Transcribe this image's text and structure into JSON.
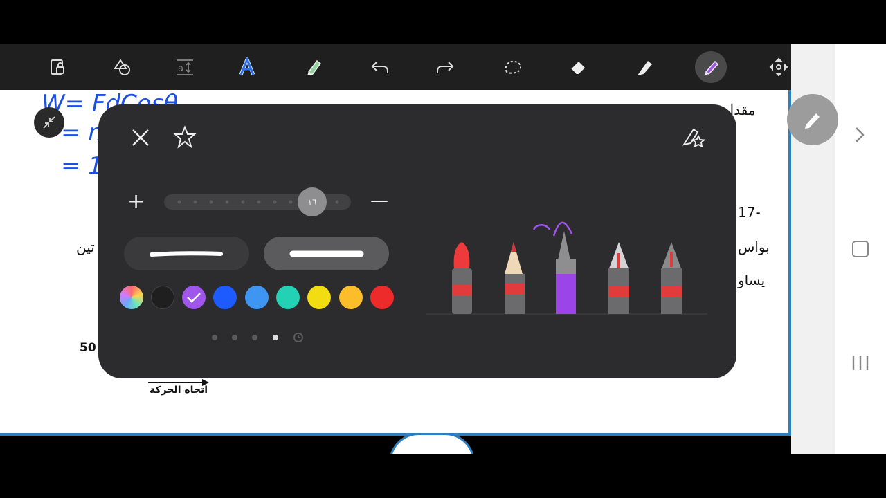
{
  "toolbar": {
    "items": [
      {
        "name": "lock-page-icon"
      },
      {
        "name": "shapes-icon"
      },
      {
        "name": "text-size-icon"
      },
      {
        "name": "text-color-icon"
      },
      {
        "name": "highlighter-pen-icon"
      },
      {
        "name": "undo-icon"
      },
      {
        "name": "redo-icon"
      },
      {
        "name": "lasso-select-icon"
      },
      {
        "name": "eraser-icon"
      },
      {
        "name": "highlighter-icon"
      },
      {
        "name": "pen-icon",
        "active": true
      },
      {
        "name": "move-icon"
      }
    ]
  },
  "document": {
    "handwriting": [
      "W= FdCosθ",
      "= m",
      "= 15"
    ],
    "lines": [
      "مقدار",
      "17-",
      "بواس",
      "يساو",
      "تين",
      "50"
    ],
    "arrow_label": "اتجاه الحركة"
  },
  "pen_panel": {
    "size_value": "١٦",
    "plus_label": "+",
    "minus_label": "—",
    "colors": [
      "gradient",
      "#1f1f1f",
      "#a056ea",
      "#1e5bff",
      "#3f95f2",
      "#23d1b4",
      "#f2dc12",
      "#fbbd2a",
      "#ee2b2b"
    ],
    "selected_color": "#a056ea",
    "pens": [
      "brush",
      "pencil",
      "marker",
      "fountain-pen",
      "calligraphy-pen"
    ],
    "selected_pen": "marker"
  },
  "colors": {
    "accent": "#a056ea",
    "page_border": "#2e7fbf"
  }
}
